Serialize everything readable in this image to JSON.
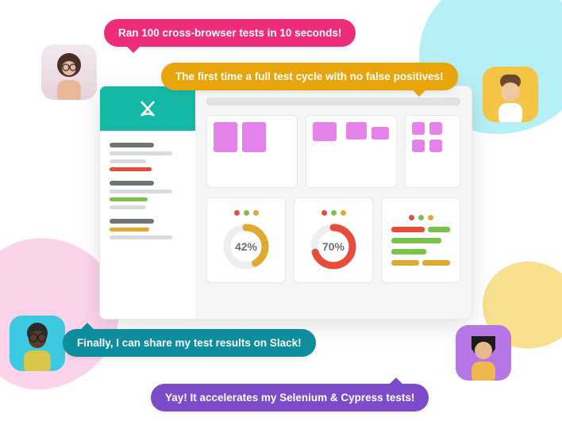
{
  "bubbles": {
    "pink": "Ran 100 cross-browser tests in 10 seconds!",
    "orange": "The first time a full test cycle with no false positives!",
    "teal": "Finally, I can share my test results on Slack!",
    "purple": "Yay! It accelerates my Selenium & Cypress tests!"
  },
  "dashboard": {
    "donut1": {
      "percent": 42,
      "label": "42%"
    },
    "donut2": {
      "percent": 70,
      "label": "70%"
    }
  },
  "colors": {
    "accent_teal": "#15b8a6",
    "red": "#e74c3c",
    "green": "#7cc24a",
    "amber": "#e3a92f",
    "magenta": "#e583ea"
  }
}
